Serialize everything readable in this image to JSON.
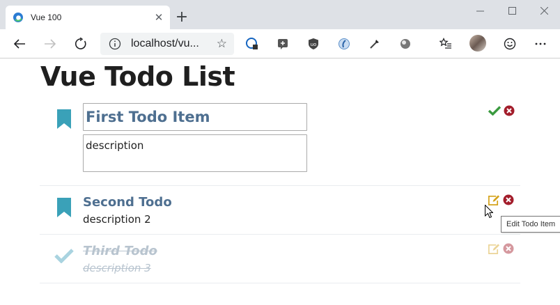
{
  "browser": {
    "tab_title": "Vue 100",
    "url": "localhost/vu...",
    "new_tab_symbol": "+"
  },
  "page": {
    "title": "Vue Todo List"
  },
  "todos": [
    {
      "title": "First Todo Item",
      "description": "description",
      "state": "editing",
      "icon": "bookmark-icon"
    },
    {
      "title": "Second Todo",
      "description": "description 2",
      "state": "active",
      "icon": "bookmark-icon"
    },
    {
      "title": "Third Todo",
      "description": "description 3",
      "state": "done",
      "icon": "check-icon"
    }
  ],
  "tooltip": {
    "text": "Edit Todo Item"
  },
  "colors": {
    "title_blue": "#4e6f90",
    "bookmark_teal": "#3aa1b8",
    "check_green": "#3a9a3f",
    "edit_gold": "#d4a21a",
    "delete_red": "#a31d2b"
  }
}
